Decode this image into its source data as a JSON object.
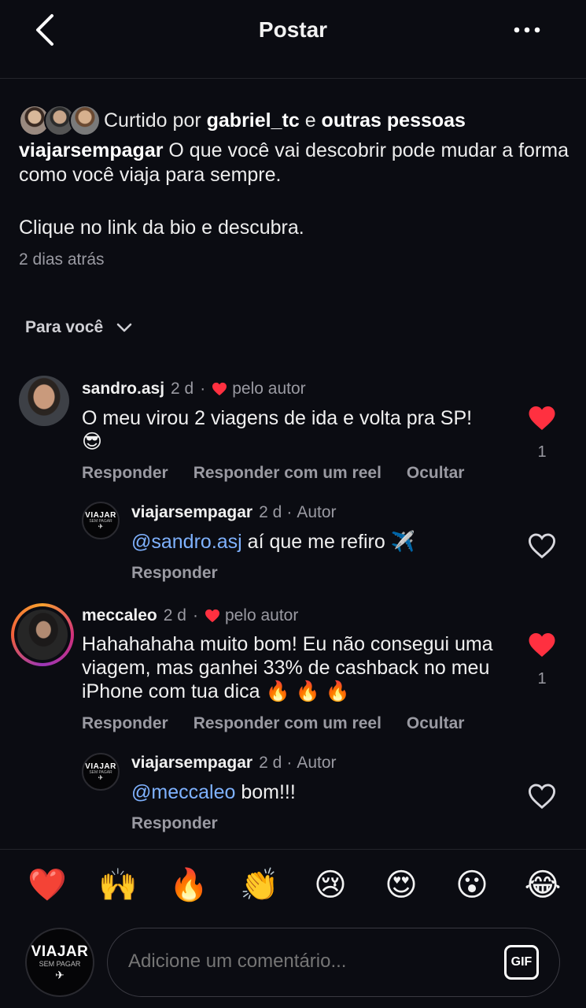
{
  "header": {
    "title": "Postar"
  },
  "post": {
    "likes_prefix": "Curtido por",
    "likes_user": "gabriel_tc",
    "likes_connector": "e",
    "likes_others": "outras pessoas",
    "caption_user": "viajarsempagar",
    "caption_text": "O que você vai descobrir pode mudar a forma como você viaja para sempre.",
    "caption_line2": "Clique no link da bio e descubra.",
    "time": "2 dias atrás"
  },
  "filter": {
    "label": "Para você"
  },
  "comments": [
    {
      "user": "sandro.asj",
      "time": "2 d",
      "sep": "·",
      "badge": "pelo autor",
      "text": "O meu virou 2 viagens de ida e volta pra SP!",
      "emoji": "😎",
      "like_count": "1",
      "actions": [
        "Responder",
        "Responder com um reel",
        "Ocultar"
      ],
      "reply": {
        "user": "viajarsempagar",
        "time": "2 d",
        "sep": "·",
        "badge": "Autor",
        "mention": "@sandro.asj",
        "text": " aí que me refiro ✈️",
        "action": "Responder"
      }
    },
    {
      "user": "meccaleo",
      "time": "2 d",
      "sep": "·",
      "badge": "pelo autor",
      "text": "Hahahahaha muito bom! Eu não consegui uma viagem, mas ganhei 33% de cashback no meu iPhone com tua dica 🔥 🔥 🔥",
      "like_count": "1",
      "actions": [
        "Responder",
        "Responder com um reel",
        "Ocultar"
      ],
      "reply": {
        "user": "viajarsempagar",
        "time": "2 d",
        "sep": "·",
        "badge": "Autor",
        "mention": "@meccaleo",
        "text": " bom!!!",
        "action": "Responder"
      }
    }
  ],
  "brand": {
    "line1": "VIAJAR",
    "line2": "SEM PAGAR",
    "plane": "✈"
  },
  "reactions": [
    "❤️",
    "🙌",
    "🔥",
    "👏",
    "😢",
    "😍",
    "😮",
    "😂"
  ],
  "composer": {
    "placeholder": "Adicione um comentário...",
    "gif_label": "GIF"
  },
  "colors": {
    "background": "#0b0c12",
    "like_red": "#ff3040",
    "mention_blue": "#7fb2ff",
    "muted": "#9a9aa2"
  },
  "icons": {
    "back": "chevron-left-icon",
    "more": "more-horizontal-icon",
    "filter": "chevron-down-icon",
    "like": "heart-icon"
  }
}
